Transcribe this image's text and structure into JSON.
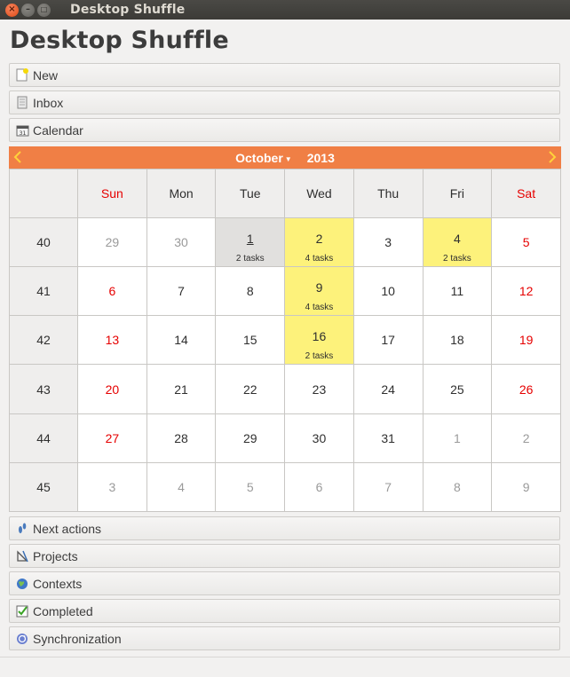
{
  "window": {
    "title": "Desktop Shuffle"
  },
  "app_title": "Desktop Shuffle",
  "sections_top": [
    {
      "label": "New",
      "icon": "new-note-icon"
    },
    {
      "label": "Inbox",
      "icon": "inbox-icon"
    },
    {
      "label": "Calendar",
      "icon": "calendar-icon"
    }
  ],
  "calendar": {
    "month": "October",
    "year": "2013",
    "weekdays": [
      "Sun",
      "Mon",
      "Tue",
      "Wed",
      "Thu",
      "Fri",
      "Sat"
    ],
    "weeks": [
      {
        "num": "40",
        "days": [
          {
            "d": "29",
            "other": true
          },
          {
            "d": "30",
            "other": true
          },
          {
            "d": "1",
            "tasks": "2 tasks",
            "today": true
          },
          {
            "d": "2",
            "tasks": "4 tasks",
            "hl": true
          },
          {
            "d": "3"
          },
          {
            "d": "4",
            "tasks": "2 tasks",
            "hl": true
          },
          {
            "d": "5"
          }
        ]
      },
      {
        "num": "41",
        "days": [
          {
            "d": "6"
          },
          {
            "d": "7"
          },
          {
            "d": "8"
          },
          {
            "d": "9",
            "tasks": "4 tasks",
            "hl": true
          },
          {
            "d": "10"
          },
          {
            "d": "11"
          },
          {
            "d": "12"
          }
        ]
      },
      {
        "num": "42",
        "days": [
          {
            "d": "13"
          },
          {
            "d": "14"
          },
          {
            "d": "15"
          },
          {
            "d": "16",
            "tasks": "2 tasks",
            "hl": true
          },
          {
            "d": "17"
          },
          {
            "d": "18"
          },
          {
            "d": "19"
          }
        ]
      },
      {
        "num": "43",
        "days": [
          {
            "d": "20"
          },
          {
            "d": "21"
          },
          {
            "d": "22"
          },
          {
            "d": "23"
          },
          {
            "d": "24"
          },
          {
            "d": "25"
          },
          {
            "d": "26"
          }
        ]
      },
      {
        "num": "44",
        "days": [
          {
            "d": "27"
          },
          {
            "d": "28"
          },
          {
            "d": "29"
          },
          {
            "d": "30"
          },
          {
            "d": "31"
          },
          {
            "d": "1",
            "other": true
          },
          {
            "d": "2",
            "other": true
          }
        ]
      },
      {
        "num": "45",
        "days": [
          {
            "d": "3",
            "other": true
          },
          {
            "d": "4",
            "other": true
          },
          {
            "d": "5",
            "other": true
          },
          {
            "d": "6",
            "other": true
          },
          {
            "d": "7",
            "other": true
          },
          {
            "d": "8",
            "other": true
          },
          {
            "d": "9",
            "other": true
          }
        ]
      }
    ]
  },
  "sections_bottom": [
    {
      "label": "Next actions",
      "icon": "footprints-icon"
    },
    {
      "label": "Projects",
      "icon": "drafting-tools-icon"
    },
    {
      "label": "Contexts",
      "icon": "globe-icon"
    },
    {
      "label": "Completed",
      "icon": "checkbox-checked-icon"
    },
    {
      "label": "Synchronization",
      "icon": "sync-icon"
    }
  ],
  "colors": {
    "accent_orange": "#f07f45",
    "task_highlight": "#fdf27b",
    "weekend_red": "#e60000"
  }
}
